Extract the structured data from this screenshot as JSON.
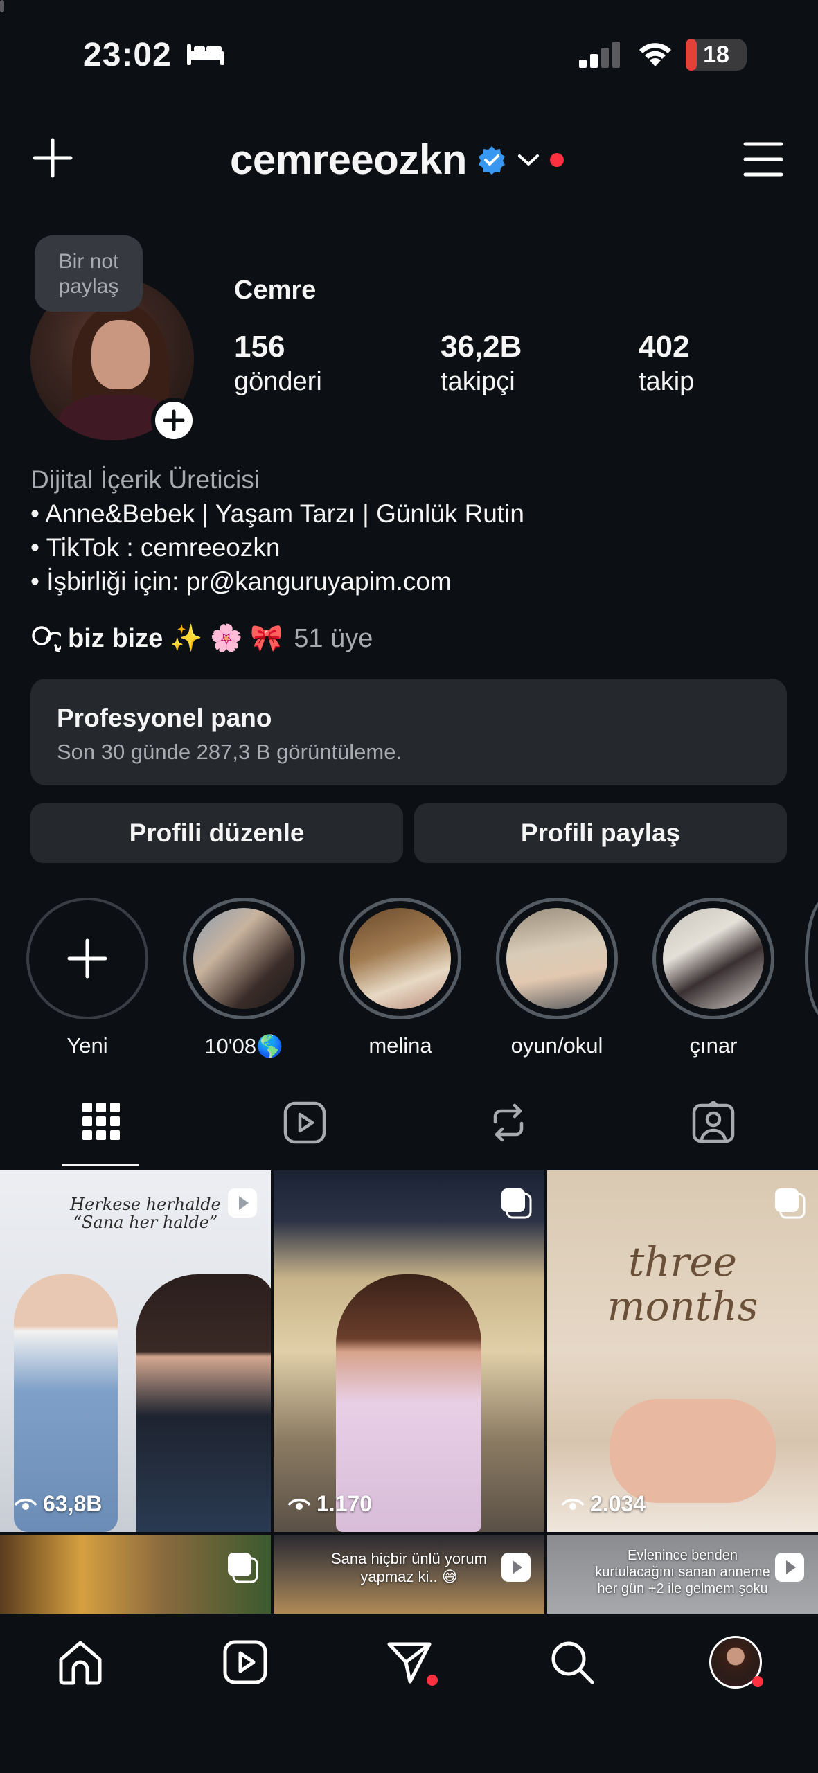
{
  "status_bar": {
    "time": "23:02",
    "battery": "18",
    "battery_level": 0.18
  },
  "header": {
    "username": "cemreeozkn"
  },
  "profile": {
    "note": "Bir not paylaş",
    "display_name": "Cemre",
    "stats": [
      {
        "value": "156",
        "label": "gönderi"
      },
      {
        "value": "36,2B",
        "label": "takipçi"
      },
      {
        "value": "402",
        "label": "takip"
      }
    ],
    "bio": {
      "category": "Dijital İçerik Üreticisi",
      "lines": [
        "• Anne&Bebek | Yaşam Tarzı | Günlük Rutin",
        "• TikTok : cemreeozkn",
        "• İşbirliği için: pr@kanguruyapim.com"
      ]
    },
    "channel": {
      "name": "biz bize",
      "emoji": "✨ 🌸 🎀",
      "members": "51 üye"
    }
  },
  "dashboard": {
    "title": "Profesyonel pano",
    "subtitle": "Son 30 günde 287,3 B görüntüleme."
  },
  "buttons": {
    "edit": "Profili düzenle",
    "share": "Profili paylaş"
  },
  "highlights": [
    {
      "label": "Yeni"
    },
    {
      "label": "10'08🌎"
    },
    {
      "label": "melina"
    },
    {
      "label": "oyun/okul"
    },
    {
      "label": "çınar"
    }
  ],
  "grid": {
    "tiles": [
      {
        "views": "63,8B",
        "caption": "Herkese herhalde “Sana her halde”"
      },
      {
        "views": "1.170"
      },
      {
        "views": "2.034",
        "caption": "three months"
      },
      {},
      {
        "caption": "Sana hiçbir ünlü yorum yapmaz ki.. 😅"
      },
      {
        "caption": "Evlenince benden kurtulacağını sanan anneme her gün +2 ile gelmem şoku"
      }
    ]
  },
  "colors": {
    "background": "#0c1014",
    "verified": "#3897f0",
    "notification": "#ff3040"
  }
}
